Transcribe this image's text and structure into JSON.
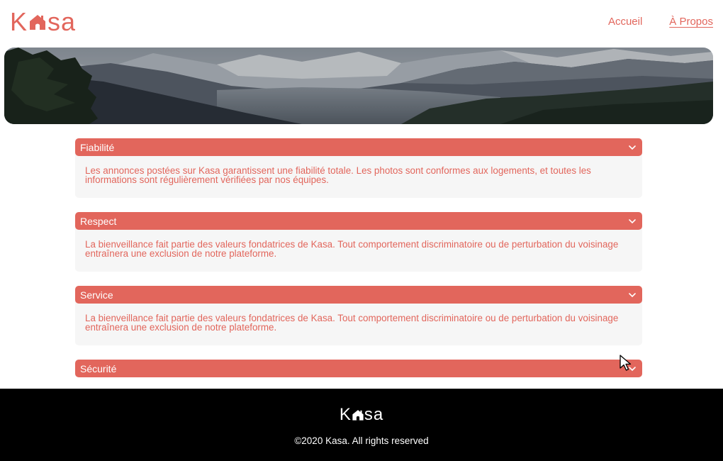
{
  "header": {
    "logo": "Kasa",
    "nav": [
      {
        "label": "Accueil",
        "active": false
      },
      {
        "label": "À Propos",
        "active": true
      }
    ]
  },
  "banner": {
    "image": "mountain-landscape"
  },
  "collapses": [
    {
      "title": "Fiabilité",
      "text": "Les annonces postées sur Kasa garantissent une fiabilité totale. Les photos sont conformes aux logements, et toutes les informations sont régulièrement vérifiées par nos équipes.",
      "open": true
    },
    {
      "title": "Respect",
      "text": "La bienveillance fait partie des valeurs fondatrices de Kasa. Tout comportement discriminatoire ou de perturbation du voisinage entraînera une exclusion de notre plateforme.",
      "open": true
    },
    {
      "title": "Service",
      "text": "La bienveillance fait partie des valeurs fondatrices de Kasa. Tout comportement discriminatoire ou de perturbation du voisinage entraînera une exclusion de notre plateforme.",
      "open": true
    },
    {
      "title": "Sécurité",
      "open": false
    }
  ],
  "footer": {
    "logo": "Kasa",
    "copyright": "©2020 Kasa. All rights reserved"
  },
  "colors": {
    "accent": "#E2665C",
    "panel": "#F6F6F6",
    "footer": "#000000"
  }
}
